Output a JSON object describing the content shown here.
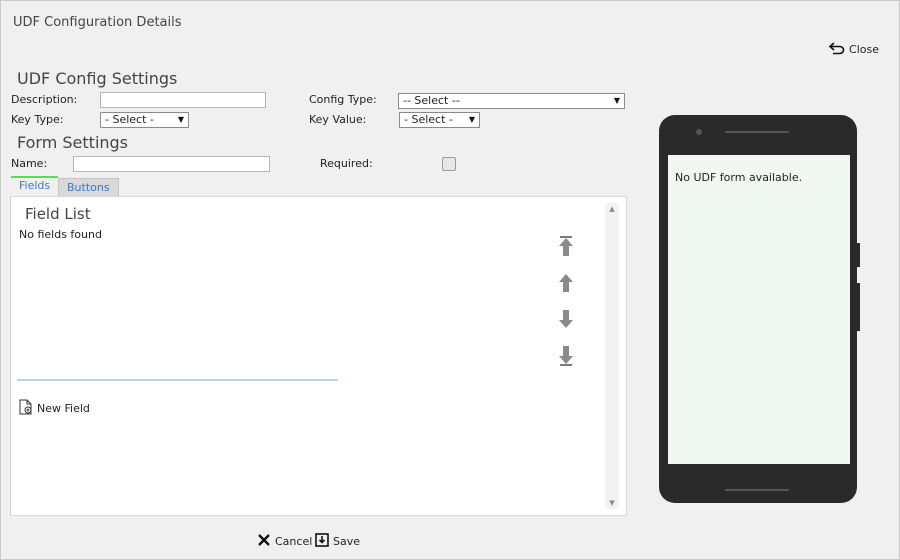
{
  "window": {
    "title": "UDF Configuration Details",
    "close_label": "Close"
  },
  "config": {
    "title": "UDF Config Settings",
    "description_label": "Description:",
    "description_value": "",
    "config_type_label": "Config Type:",
    "config_type_value": "-- Select --",
    "key_type_label": "Key Type:",
    "key_type_value": "- Select -",
    "key_value_label": "Key Value:",
    "key_value_value": "- Select -"
  },
  "form": {
    "title": "Form Settings",
    "name_label": "Name:",
    "name_value": "",
    "required_label": "Required:",
    "required_checked": false
  },
  "tabs": [
    {
      "label": "Fields",
      "active": true
    },
    {
      "label": "Buttons",
      "active": false
    }
  ],
  "field_list": {
    "title": "Field List",
    "empty_text": "No fields found",
    "new_field_label": "New Field"
  },
  "footer": {
    "cancel_label": "Cancel",
    "save_label": "Save"
  },
  "preview": {
    "empty_text": "No UDF form available."
  },
  "colors": {
    "tab_active_border": "#55dd55",
    "link_blue": "#3a78c3",
    "phone_body": "#2a2a2a",
    "phone_screen": "#f1f8f1"
  }
}
